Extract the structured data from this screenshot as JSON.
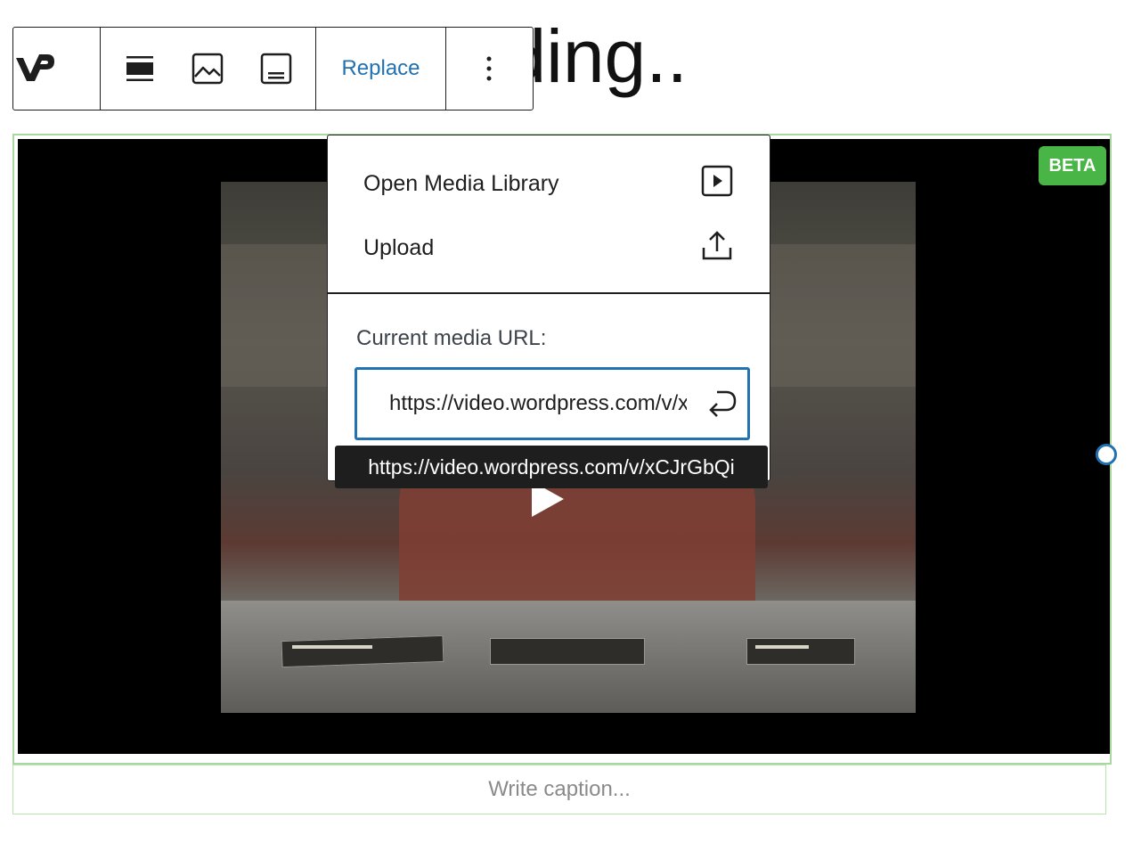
{
  "page": {
    "heading": "Preloaded heading.."
  },
  "toolbar": {
    "logo_icon": "videopress-logo-icon",
    "align_icon": "align-wide-icon",
    "poster_icon": "image-icon",
    "caption_icon": "caption-icon",
    "replace_label": "Replace",
    "more_icon": "more-vertical-icon",
    "accent": "#2271b1"
  },
  "video": {
    "badge": "BETA",
    "badge_color": "#4ab547",
    "play_icon": "play-icon"
  },
  "replace_menu": {
    "items": [
      {
        "label": "Open Media Library",
        "icon": "media-library-icon"
      },
      {
        "label": "Upload",
        "icon": "upload-icon"
      }
    ],
    "url_label": "Current media URL:",
    "url_value": "https://video.wordpress.com/v/xCJrGbQi",
    "submit_icon": "enter-icon",
    "tooltip": "https://video.wordpress.com/v/xCJrGbQi"
  },
  "caption": {
    "placeholder": "Write caption..."
  }
}
